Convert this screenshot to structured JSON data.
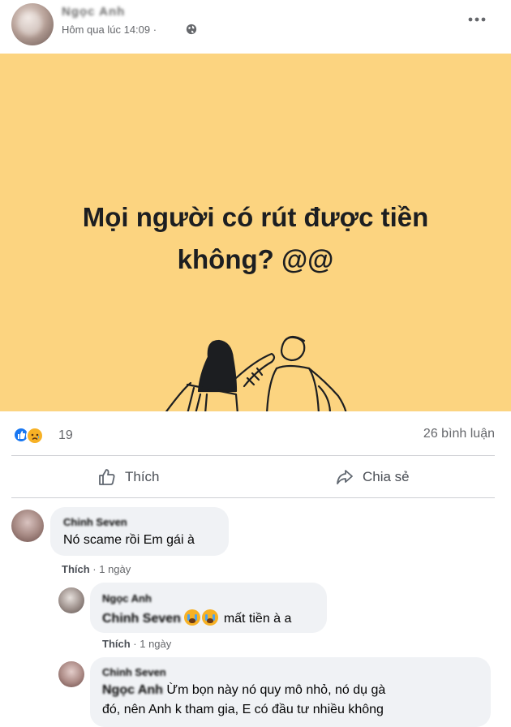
{
  "post": {
    "author": "Ngọc Anh",
    "time": "Hôm qua lúc 14:09 ·",
    "banner_text": "Mọi người có rút được tiền không? @@",
    "banner_color": "#fcd480"
  },
  "stats": {
    "reaction_count": "19",
    "comment_count": "26 bình luận",
    "reactions": [
      "like-icon",
      "sad-icon"
    ]
  },
  "actions": {
    "like_label": "Thích",
    "share_label": "Chia sẻ"
  },
  "comments": [
    {
      "author": "Chinh Seven",
      "text": "Nó scame rồi Em gái à",
      "like": "Thích",
      "time": "· 1 ngày"
    },
    {
      "author": "Ngọc Anh",
      "mention": "Chinh Seven",
      "text": "mất tiền à a",
      "like": "Thích",
      "time": "· 1 ngày"
    },
    {
      "author": "Chinh Seven",
      "mention": "Ngọc Anh",
      "text_line1": "Ừm bọn này nó quy mô nhỏ, nó dụ gà",
      "text_line2": "đó, nên Anh k tham gia, E có đầu tư nhiều không"
    }
  ]
}
